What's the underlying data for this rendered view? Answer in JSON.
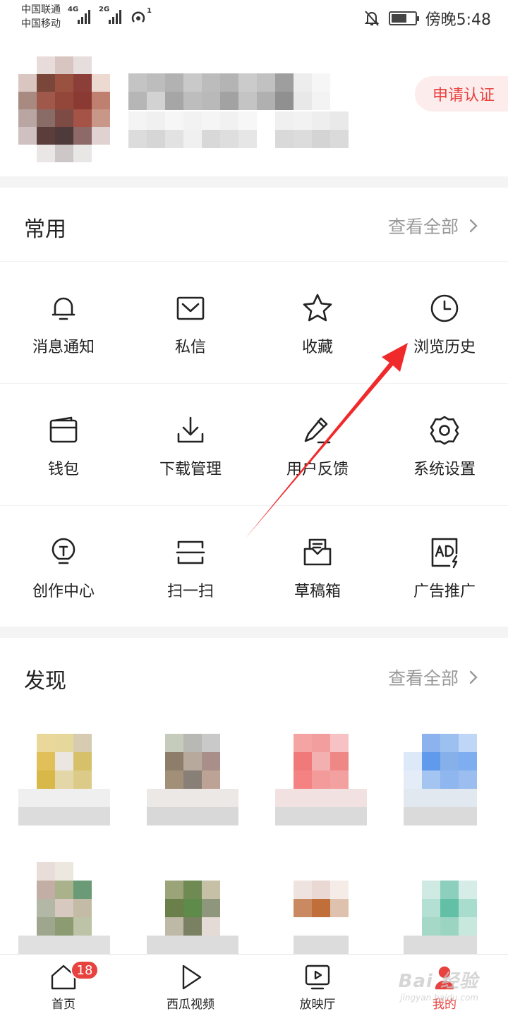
{
  "status_bar": {
    "carrier_1": "中国联通",
    "carrier_2": "中国移动",
    "net_1": "4G",
    "net_2": "2G",
    "hotspot_sub": "1",
    "time": "傍晚5:48"
  },
  "profile": {
    "cert_button": "申请认证"
  },
  "common": {
    "title": "常用",
    "see_all": "查看全部",
    "items": [
      {
        "label": "消息通知",
        "icon": "bell-icon"
      },
      {
        "label": "私信",
        "icon": "envelope-icon"
      },
      {
        "label": "收藏",
        "icon": "star-icon"
      },
      {
        "label": "浏览历史",
        "icon": "clock-icon"
      },
      {
        "label": "钱包",
        "icon": "wallet-icon"
      },
      {
        "label": "下载管理",
        "icon": "download-icon"
      },
      {
        "label": "用户反馈",
        "icon": "pencil-icon"
      },
      {
        "label": "系统设置",
        "icon": "gear-icon"
      },
      {
        "label": "创作中心",
        "icon": "lightbulb-icon"
      },
      {
        "label": "扫一扫",
        "icon": "scan-icon"
      },
      {
        "label": "草稿箱",
        "icon": "draft-box-icon"
      },
      {
        "label": "广告推广",
        "icon": "ad-icon"
      }
    ]
  },
  "discover": {
    "title": "发现",
    "see_all": "查看全部"
  },
  "tabbar": {
    "tabs": [
      {
        "label": "首页",
        "icon": "home-icon",
        "badge": "18"
      },
      {
        "label": "西瓜视频",
        "icon": "play-icon"
      },
      {
        "label": "放映厅",
        "icon": "screen-icon"
      },
      {
        "label": "我的",
        "icon": "profile-icon",
        "active": true
      }
    ]
  },
  "watermark": {
    "brand": "Bai 经验",
    "url": "jingyan.baidu.com"
  },
  "colors": {
    "accent": "#e8423e",
    "cert_bg": "#fdecec",
    "annotation_arrow": "#f02a2a"
  }
}
